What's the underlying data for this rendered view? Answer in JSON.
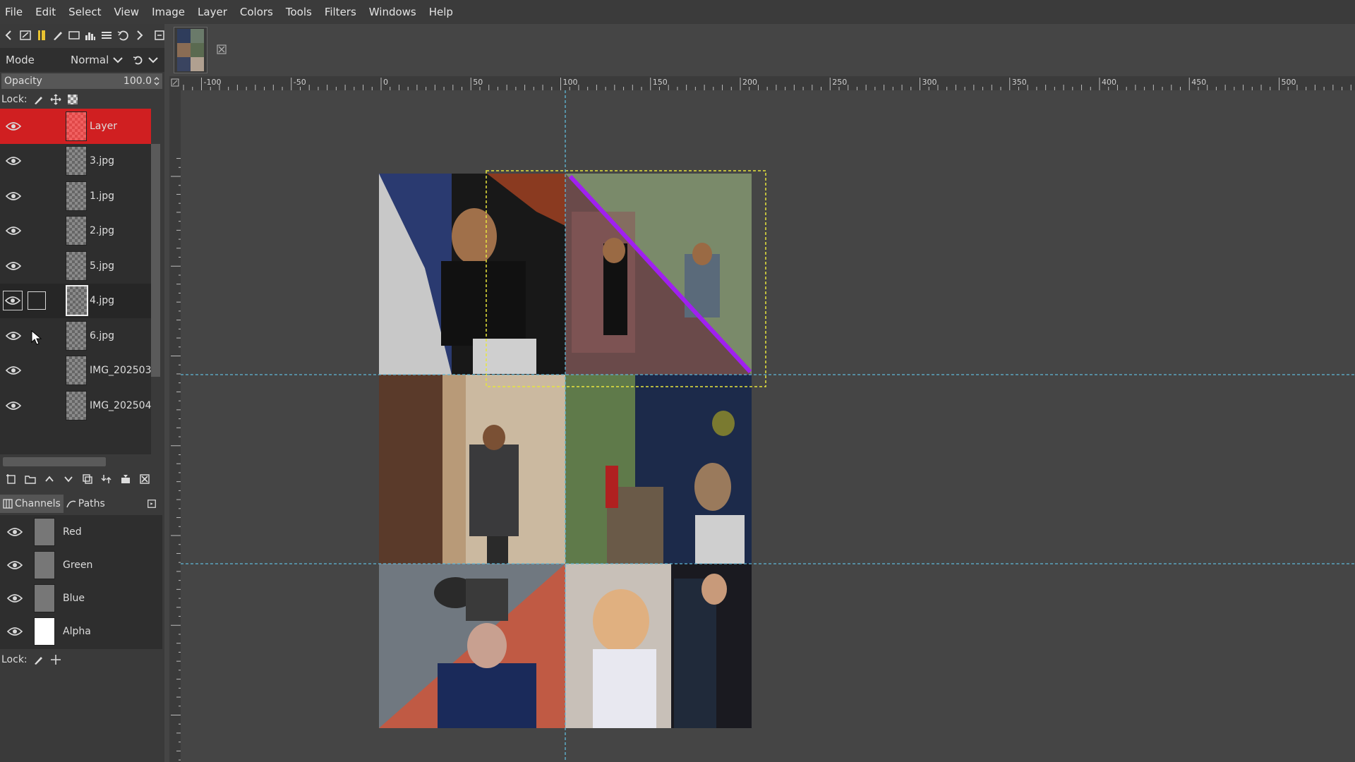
{
  "menu": [
    "File",
    "Edit",
    "Select",
    "View",
    "Image",
    "Layer",
    "Colors",
    "Tools",
    "Filters",
    "Windows",
    "Help"
  ],
  "layers_panel": {
    "mode_label": "Mode",
    "mode_value": "Normal",
    "opacity_label": "Opacity",
    "opacity_value": "100.0",
    "lock_label": "Lock:",
    "layers": [
      {
        "name": "Layer",
        "selected": true
      },
      {
        "name": "3.jpg"
      },
      {
        "name": "1.jpg"
      },
      {
        "name": "2.jpg"
      },
      {
        "name": "5.jpg"
      },
      {
        "name": "4.jpg",
        "hover": true
      },
      {
        "name": "6.jpg"
      },
      {
        "name": "IMG_202503"
      },
      {
        "name": "IMG_202504"
      }
    ]
  },
  "channels_panel": {
    "tab_channels": "Channels",
    "tab_paths": "Paths",
    "channels": [
      {
        "name": "Red"
      },
      {
        "name": "Green"
      },
      {
        "name": "Blue"
      },
      {
        "name": "Alpha"
      }
    ],
    "lock_label": "Lock:"
  },
  "ruler": {
    "h_labels": [
      "-100",
      "-50",
      "0",
      "50",
      "100",
      "150",
      "200",
      "250",
      "300",
      "350",
      "400",
      "450",
      "500"
    ]
  },
  "colors": {
    "selected_layer": "#d01f21",
    "guide": "#5fb8d8",
    "selection_outline": "#e8e53c",
    "drawn_line": "#a020f0"
  },
  "icons": {
    "layer_visibility": "eye-icon",
    "lock_pixels": "brush-icon",
    "lock_position": "move-icon",
    "lock_alpha": "checker-icon",
    "close_image": "close-icon"
  }
}
